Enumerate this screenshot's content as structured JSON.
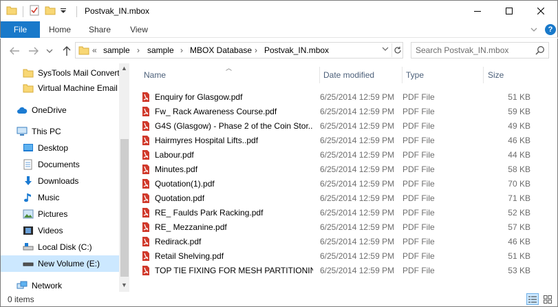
{
  "window": {
    "title": "Postvak_IN.mbox",
    "controls": {
      "minimize_icon": "minimize-icon",
      "maximize_icon": "maximize-icon",
      "close_icon": "close-icon"
    }
  },
  "ribbon": {
    "tabs": [
      {
        "label": "File"
      },
      {
        "label": "Home"
      },
      {
        "label": "Share"
      },
      {
        "label": "View"
      }
    ],
    "accent": "#1979ca"
  },
  "address": {
    "prefix": "«",
    "crumbs": [
      "sample",
      "sample",
      "MBOX Database",
      "Postvak_IN.mbox"
    ],
    "separator": "›"
  },
  "search": {
    "placeholder": "Search Postvak_IN.mbox"
  },
  "sidebar": {
    "items": [
      {
        "label": "SysTools Mail Convert",
        "icon": "folder-icon"
      },
      {
        "label": "Virtual Machine Email",
        "icon": "folder-icon"
      },
      {
        "label": "OneDrive",
        "icon": "cloud-icon"
      },
      {
        "label": "This PC",
        "icon": "computer-icon"
      },
      {
        "label": "Desktop",
        "icon": "desktop-icon"
      },
      {
        "label": "Documents",
        "icon": "documents-icon"
      },
      {
        "label": "Downloads",
        "icon": "download-icon"
      },
      {
        "label": "Music",
        "icon": "music-icon"
      },
      {
        "label": "Pictures",
        "icon": "pictures-icon"
      },
      {
        "label": "Videos",
        "icon": "videos-icon"
      },
      {
        "label": "Local Disk (C:)",
        "icon": "drive-icon"
      },
      {
        "label": "New Volume (E:)",
        "icon": "drive-icon",
        "selected": true
      },
      {
        "label": "Network",
        "icon": "network-icon"
      }
    ]
  },
  "columns": {
    "name": "Name",
    "date": "Date modified",
    "type": "Type",
    "size": "Size"
  },
  "files": [
    {
      "name": "Enquiry for Glasgow.pdf",
      "date": "6/25/2014 12:59 PM",
      "type": "PDF File",
      "size": "51 KB"
    },
    {
      "name": "Fw_ Rack Awareness Course.pdf",
      "date": "6/25/2014 12:59 PM",
      "type": "PDF File",
      "size": "59 KB"
    },
    {
      "name": "G4S (Glasgow) - Phase 2 of the Coin Stor...",
      "date": "6/25/2014 12:59 PM",
      "type": "PDF File",
      "size": "49 KB"
    },
    {
      "name": "Hairmyres Hospital Lifts..pdf",
      "date": "6/25/2014 12:59 PM",
      "type": "PDF File",
      "size": "46 KB"
    },
    {
      "name": "Labour.pdf",
      "date": "6/25/2014 12:59 PM",
      "type": "PDF File",
      "size": "44 KB"
    },
    {
      "name": "Minutes.pdf",
      "date": "6/25/2014 12:59 PM",
      "type": "PDF File",
      "size": "58 KB"
    },
    {
      "name": "Quotation(1).pdf",
      "date": "6/25/2014 12:59 PM",
      "type": "PDF File",
      "size": "70 KB"
    },
    {
      "name": "Quotation.pdf",
      "date": "6/25/2014 12:59 PM",
      "type": "PDF File",
      "size": "71 KB"
    },
    {
      "name": "RE_ Faulds Park Racking.pdf",
      "date": "6/25/2014 12:59 PM",
      "type": "PDF File",
      "size": "52 KB"
    },
    {
      "name": "RE_ Mezzanine.pdf",
      "date": "6/25/2014 12:59 PM",
      "type": "PDF File",
      "size": "57 KB"
    },
    {
      "name": "Redirack.pdf",
      "date": "6/25/2014 12:59 PM",
      "type": "PDF File",
      "size": "46 KB"
    },
    {
      "name": "Retail Shelving.pdf",
      "date": "6/25/2014 12:59 PM",
      "type": "PDF File",
      "size": "51 KB"
    },
    {
      "name": "TOP TIE FIXING FOR MESH PARTITIONIN...",
      "date": "6/25/2014 12:59 PM",
      "type": "PDF File",
      "size": "53 KB"
    }
  ],
  "status": {
    "items_text": "0 items"
  },
  "colors": {
    "selection": "#cce8ff",
    "pdf": "#d0392b",
    "folder": "#f8d775"
  }
}
